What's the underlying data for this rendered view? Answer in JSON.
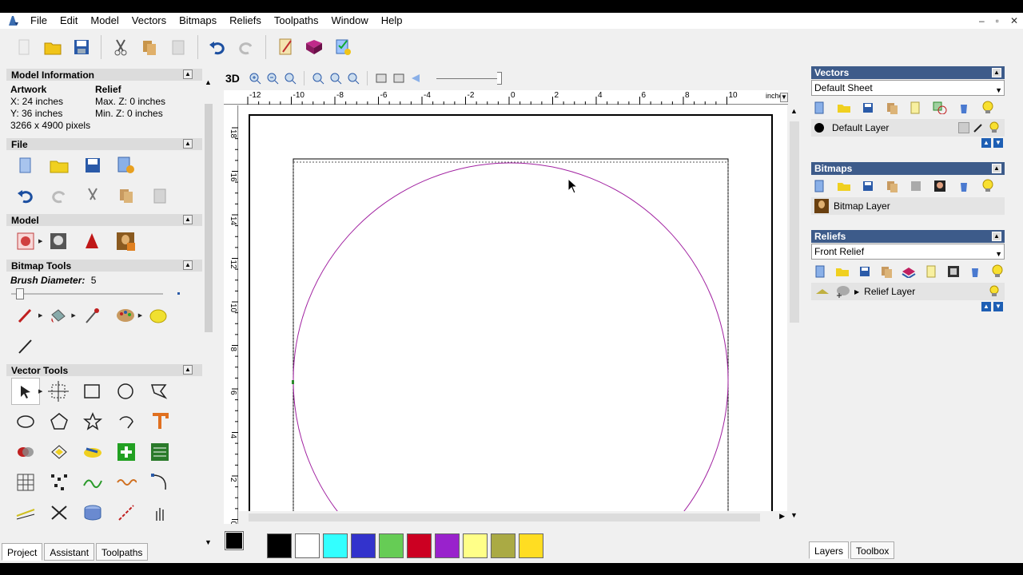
{
  "menu": {
    "items": [
      "File",
      "Edit",
      "Model",
      "Vectors",
      "Bitmaps",
      "Reliefs",
      "Toolpaths",
      "Window",
      "Help"
    ]
  },
  "window_controls": [
    "–",
    "▫",
    "✕"
  ],
  "view_toolbar": {
    "label_3d": "3D"
  },
  "left_panel": {
    "model_info": {
      "title": "Model Information",
      "artwork_label": "Artwork",
      "relief_label": "Relief",
      "x": "X: 24 inches",
      "maxz": "Max. Z: 0 inches",
      "y": "Y: 36 inches",
      "minz": "Min. Z: 0 inches",
      "pixels": "3266 x 4900 pixels"
    },
    "file_title": "File",
    "model_title": "Model",
    "bitmap_tools_title": "Bitmap Tools",
    "brush_label": "Brush Diameter:",
    "brush_value": "5",
    "vector_tools_title": "Vector Tools"
  },
  "left_tabs": [
    "Project",
    "Assistant",
    "Toolpaths"
  ],
  "ruler": {
    "units": "inches",
    "x_ticks": [
      "-12",
      "-10",
      "-8",
      "-6",
      "-4",
      "-2",
      "0",
      "2",
      "4",
      "6",
      "8",
      "10"
    ],
    "y_ticks": [
      "18",
      "16",
      "14",
      "12",
      "10",
      "8",
      "6",
      "4",
      "2",
      "0"
    ]
  },
  "palette": {
    "colors": [
      "#000000",
      "#ffffff",
      "#33ffff",
      "#3333cc",
      "#66cc55",
      "#cc0022",
      "#9922cc",
      "#ffff88",
      "#aaaa44",
      "#ffdd22"
    ]
  },
  "right_panel": {
    "vectors": {
      "title": "Vectors",
      "sheet": "Default Sheet",
      "layer": "Default Layer"
    },
    "bitmaps": {
      "title": "Bitmaps",
      "layer": "Bitmap Layer"
    },
    "reliefs": {
      "title": "Reliefs",
      "relief": "Front Relief",
      "layer": "Relief Layer"
    }
  },
  "right_tabs": [
    "Layers",
    "Toolbox"
  ]
}
